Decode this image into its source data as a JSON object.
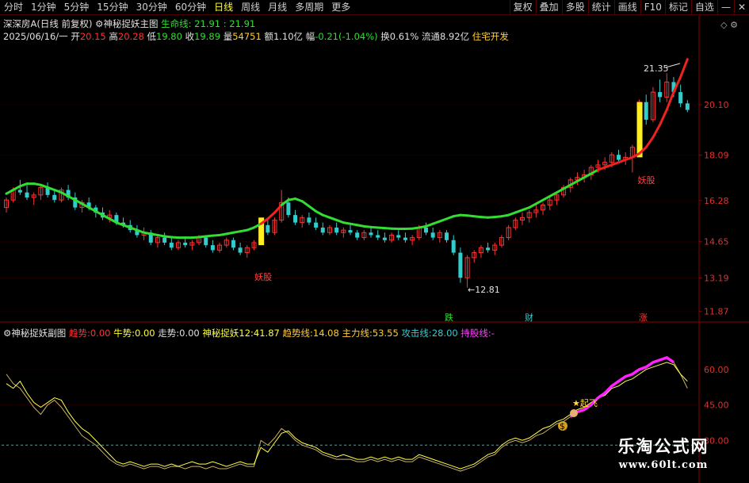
{
  "toolbar": {
    "periods": [
      "分时",
      "1分钟",
      "5分钟",
      "15分钟",
      "30分钟",
      "60分钟",
      "日线",
      "周线",
      "月线",
      "多周期",
      "更多"
    ],
    "active_index": 6,
    "right_items": [
      "复权",
      "叠加",
      "多股",
      "统计",
      "画线",
      "F10",
      "标记",
      "自选"
    ],
    "minimize_icon": "minimize-icon",
    "close_icon": "close-icon"
  },
  "main_info": {
    "stock": "深深房A",
    "stock_suffix": "(日线 前复权)",
    "indicator": "神秘捉妖主图",
    "life_label": "生命线:",
    "life_value": "21.91",
    "life_value2": "21.91",
    "date": "2025/06/16/一",
    "open_label": "开",
    "open": "20.15",
    "high_label": "高",
    "high": "20.28",
    "low_label": "低",
    "low": "19.80",
    "close_label": "收",
    "close": "19.89",
    "vol_label": "量",
    "vol": "54751",
    "amount_label": "额",
    "amount": "1.10亿",
    "change_label": "幅",
    "change": "-0.21(-1.04%)",
    "turnover_label": "换",
    "turnover": "0.61%",
    "float_label": "流通",
    "float": "8.92亿",
    "sector": "住宅开发"
  },
  "y_axis": [
    "20.10",
    "18.09",
    "16.28",
    "14.65",
    "13.19",
    "11.87"
  ],
  "annotations": {
    "high_mark": "21.35",
    "low_mark": "12.81",
    "yao1": "妖股",
    "yao2": "妖股",
    "die": "跌",
    "cai": "财",
    "zhang": "涨"
  },
  "sub_info": {
    "name": "神秘捉妖副图",
    "trend_label": "趋势:",
    "trend": "0.00",
    "bull_label": "牛势:",
    "bull": "0.00",
    "walk_label": "走势:",
    "walk": "0.00",
    "yao12_label": "神秘捉妖12:",
    "yao12": "41.87",
    "trendline_label": "趋势线:",
    "trendline": "14.08",
    "main_label": "主力线:",
    "main": "53.55",
    "attack_label": "攻击线:",
    "attack": "28.00",
    "hold_label": "持股线:",
    "hold": "-"
  },
  "sub_axis": [
    "60.00",
    "45.00",
    "30.00"
  ],
  "sub_annotation": "起飞",
  "coin_mark": "$",
  "watermark": {
    "title": "乐淘公式网",
    "url": "www.60lt.com"
  },
  "colors": {
    "up": "#ff3333",
    "down": "#33cccc",
    "life_green": "#33dd33",
    "life_red": "#ee2222",
    "yellow_bar": "#ffee22",
    "magenta": "#ff22ff"
  },
  "chart_data": {
    "type": "line",
    "title": "",
    "ylim": [
      11.5,
      22.5
    ],
    "yticks": [
      20.1,
      18.09,
      16.28,
      14.65,
      13.19,
      11.87
    ],
    "candles": [
      [
        16.0,
        16.4,
        15.8,
        16.3
      ],
      [
        16.3,
        16.8,
        16.2,
        16.7
      ],
      [
        16.7,
        17.1,
        16.5,
        16.6
      ],
      [
        16.6,
        16.9,
        16.3,
        16.4
      ],
      [
        16.4,
        16.6,
        16.1,
        16.5
      ],
      [
        16.5,
        16.9,
        16.3,
        16.8
      ],
      [
        16.8,
        17.0,
        16.4,
        16.5
      ],
      [
        16.5,
        16.7,
        16.2,
        16.3
      ],
      [
        16.3,
        16.8,
        16.2,
        16.7
      ],
      [
        16.7,
        16.9,
        16.3,
        16.4
      ],
      [
        16.4,
        16.6,
        15.9,
        16.0
      ],
      [
        16.0,
        16.3,
        15.8,
        16.2
      ],
      [
        16.2,
        16.4,
        15.9,
        16.0
      ],
      [
        16.0,
        16.1,
        15.6,
        15.8
      ],
      [
        15.8,
        16.0,
        15.5,
        15.6
      ],
      [
        15.6,
        15.9,
        15.4,
        15.7
      ],
      [
        15.7,
        15.8,
        15.3,
        15.4
      ],
      [
        15.4,
        15.6,
        15.2,
        15.3
      ],
      [
        15.3,
        15.5,
        15.0,
        15.1
      ],
      [
        15.1,
        15.3,
        14.8,
        14.9
      ],
      [
        14.9,
        15.2,
        14.7,
        15.0
      ],
      [
        15.0,
        15.1,
        14.5,
        14.6
      ],
      [
        14.6,
        14.9,
        14.4,
        14.8
      ],
      [
        14.8,
        15.0,
        14.5,
        14.6
      ],
      [
        14.6,
        14.8,
        14.3,
        14.4
      ],
      [
        14.4,
        14.7,
        14.3,
        14.6
      ],
      [
        14.6,
        14.8,
        14.4,
        14.5
      ],
      [
        14.5,
        14.7,
        14.3,
        14.6
      ],
      [
        14.6,
        14.9,
        14.5,
        14.8
      ],
      [
        14.8,
        14.9,
        14.4,
        14.5
      ],
      [
        14.5,
        14.7,
        14.2,
        14.3
      ],
      [
        14.3,
        14.6,
        14.2,
        14.5
      ],
      [
        14.5,
        14.8,
        14.4,
        14.7
      ],
      [
        14.7,
        14.8,
        14.3,
        14.4
      ],
      [
        14.4,
        14.6,
        14.1,
        14.2
      ],
      [
        14.2,
        14.5,
        14.0,
        14.4
      ],
      [
        14.4,
        14.7,
        14.3,
        14.6
      ],
      [
        14.6,
        15.4,
        14.5,
        15.3
      ],
      [
        15.3,
        15.5,
        14.9,
        15.0
      ],
      [
        15.0,
        15.6,
        14.9,
        15.5
      ],
      [
        15.5,
        16.7,
        15.4,
        16.2
      ],
      [
        16.2,
        16.4,
        15.6,
        15.7
      ],
      [
        15.7,
        15.9,
        15.3,
        15.4
      ],
      [
        15.4,
        15.7,
        15.2,
        15.6
      ],
      [
        15.6,
        15.8,
        15.3,
        15.4
      ],
      [
        15.4,
        15.6,
        15.1,
        15.2
      ],
      [
        15.2,
        15.4,
        14.9,
        15.0
      ],
      [
        15.0,
        15.3,
        14.9,
        15.2
      ],
      [
        15.2,
        15.4,
        14.9,
        15.0
      ],
      [
        15.0,
        15.2,
        14.8,
        15.1
      ],
      [
        15.1,
        15.3,
        14.9,
        15.0
      ],
      [
        15.0,
        15.1,
        14.7,
        14.8
      ],
      [
        14.8,
        15.1,
        14.7,
        15.0
      ],
      [
        15.0,
        15.2,
        14.8,
        14.9
      ],
      [
        14.9,
        15.1,
        14.7,
        14.8
      ],
      [
        14.8,
        15.0,
        14.6,
        14.7
      ],
      [
        14.7,
        15.0,
        14.6,
        14.9
      ],
      [
        14.9,
        15.1,
        14.7,
        14.8
      ],
      [
        14.8,
        15.0,
        14.6,
        14.7
      ],
      [
        14.7,
        14.9,
        14.5,
        14.8
      ],
      [
        14.8,
        15.3,
        14.7,
        15.2
      ],
      [
        15.2,
        15.4,
        14.9,
        15.0
      ],
      [
        15.0,
        15.2,
        14.7,
        14.8
      ],
      [
        14.8,
        15.1,
        14.6,
        15.0
      ],
      [
        15.0,
        15.1,
        14.6,
        14.7
      ],
      [
        14.7,
        14.9,
        14.1,
        14.2
      ],
      [
        14.2,
        14.4,
        13.0,
        13.2
      ],
      [
        13.2,
        14.1,
        12.81,
        14.0
      ],
      [
        14.0,
        14.3,
        13.8,
        14.2
      ],
      [
        14.2,
        14.5,
        14.0,
        14.4
      ],
      [
        14.4,
        14.6,
        14.2,
        14.3
      ],
      [
        14.3,
        14.6,
        14.1,
        14.5
      ],
      [
        14.5,
        14.9,
        14.4,
        14.8
      ],
      [
        14.8,
        15.3,
        14.7,
        15.2
      ],
      [
        15.2,
        15.6,
        15.1,
        15.5
      ],
      [
        15.5,
        15.8,
        15.3,
        15.6
      ],
      [
        15.6,
        15.9,
        15.4,
        15.8
      ],
      [
        15.8,
        16.1,
        15.6,
        15.9
      ],
      [
        15.9,
        16.2,
        15.7,
        16.1
      ],
      [
        16.1,
        16.4,
        15.9,
        16.3
      ],
      [
        16.3,
        16.6,
        16.1,
        16.5
      ],
      [
        16.5,
        16.9,
        16.4,
        16.8
      ],
      [
        16.8,
        17.2,
        16.6,
        17.1
      ],
      [
        17.1,
        17.4,
        16.9,
        17.2
      ],
      [
        17.2,
        17.5,
        17.0,
        17.3
      ],
      [
        17.3,
        17.7,
        17.1,
        17.6
      ],
      [
        17.6,
        17.9,
        17.4,
        17.7
      ],
      [
        17.7,
        18.0,
        17.5,
        17.8
      ],
      [
        17.8,
        18.2,
        17.6,
        18.1
      ],
      [
        18.1,
        18.3,
        17.8,
        17.9
      ],
      [
        17.9,
        18.2,
        17.7,
        18.0
      ],
      [
        18.0,
        18.5,
        17.4,
        18.4
      ],
      [
        18.4,
        20.3,
        18.3,
        20.2
      ],
      [
        20.2,
        20.5,
        19.3,
        19.5
      ],
      [
        19.5,
        20.8,
        19.4,
        20.6
      ],
      [
        20.6,
        21.1,
        20.2,
        20.4
      ],
      [
        20.4,
        21.35,
        20.2,
        21.0
      ],
      [
        21.0,
        21.2,
        20.4,
        20.6
      ],
      [
        20.6,
        20.9,
        20.0,
        20.15
      ],
      [
        20.15,
        20.28,
        19.8,
        19.89
      ]
    ],
    "life_line": [
      16.55,
      16.7,
      16.85,
      16.95,
      16.95,
      16.9,
      16.8,
      16.7,
      16.6,
      16.45,
      16.3,
      16.15,
      16.0,
      15.85,
      15.7,
      15.55,
      15.4,
      15.3,
      15.2,
      15.1,
      15.0,
      14.95,
      14.9,
      14.85,
      14.82,
      14.8,
      14.8,
      14.8,
      14.82,
      14.85,
      14.88,
      14.9,
      14.95,
      15.0,
      15.05,
      15.1,
      15.2,
      15.35,
      15.55,
      15.8,
      16.1,
      16.3,
      16.35,
      16.25,
      16.05,
      15.85,
      15.7,
      15.6,
      15.5,
      15.4,
      15.35,
      15.3,
      15.25,
      15.22,
      15.2,
      15.18,
      15.16,
      15.15,
      15.15,
      15.16,
      15.2,
      15.25,
      15.35,
      15.45,
      15.55,
      15.65,
      15.7,
      15.68,
      15.65,
      15.62,
      15.6,
      15.62,
      15.65,
      15.7,
      15.8,
      15.9,
      16.0,
      16.15,
      16.3,
      16.45,
      16.6,
      16.75,
      16.9,
      17.05,
      17.2,
      17.35,
      17.5,
      17.6,
      17.7,
      17.8,
      17.9,
      18.0,
      18.15,
      18.4,
      18.8,
      19.3,
      19.9,
      20.6,
      21.2,
      21.91
    ],
    "sub": {
      "ylim": [
        15,
        72
      ],
      "line1": [
        54,
        52,
        55,
        50,
        46,
        44,
        46,
        48,
        47,
        42,
        38,
        35,
        33,
        30,
        27,
        24,
        21,
        20,
        21,
        20,
        19,
        20,
        20,
        19,
        20,
        19,
        20,
        21,
        20,
        20,
        21,
        20,
        19,
        20,
        21,
        20,
        20,
        27,
        25,
        29,
        33,
        34,
        31,
        29,
        28,
        27,
        25,
        24,
        23,
        24,
        23,
        22,
        22,
        23,
        22,
        23,
        22,
        23,
        22,
        22,
        24,
        23,
        22,
        21,
        20,
        19,
        18,
        19,
        20,
        22,
        24,
        25,
        28,
        30,
        31,
        30,
        31,
        33,
        35,
        36,
        38,
        39,
        41,
        43,
        44,
        46,
        48,
        49,
        52,
        53,
        55,
        56,
        58,
        60,
        61,
        62,
        63,
        62,
        58,
        55
      ],
      "line2": [
        58,
        54,
        52,
        48,
        44,
        41,
        45,
        47,
        44,
        40,
        36,
        32,
        30,
        28,
        25,
        22,
        20,
        19,
        20,
        19,
        18,
        19,
        19,
        18,
        19,
        19,
        18,
        19,
        19,
        18,
        19,
        18,
        18,
        19,
        20,
        19,
        19,
        30,
        28,
        31,
        35,
        33,
        30,
        28,
        27,
        26,
        24,
        23,
        22,
        22,
        22,
        21,
        21,
        22,
        21,
        22,
        21,
        22,
        21,
        21,
        23,
        22,
        21,
        20,
        19,
        18,
        17,
        18,
        19,
        21,
        23,
        24,
        27,
        29,
        30,
        29,
        30,
        32,
        33,
        35,
        37,
        38,
        40,
        42,
        43,
        45,
        48,
        50,
        53,
        55,
        57,
        58,
        60,
        61,
        63,
        64,
        65,
        63,
        58,
        52
      ],
      "magenta_start": 82,
      "dashed_level": 28
    }
  }
}
